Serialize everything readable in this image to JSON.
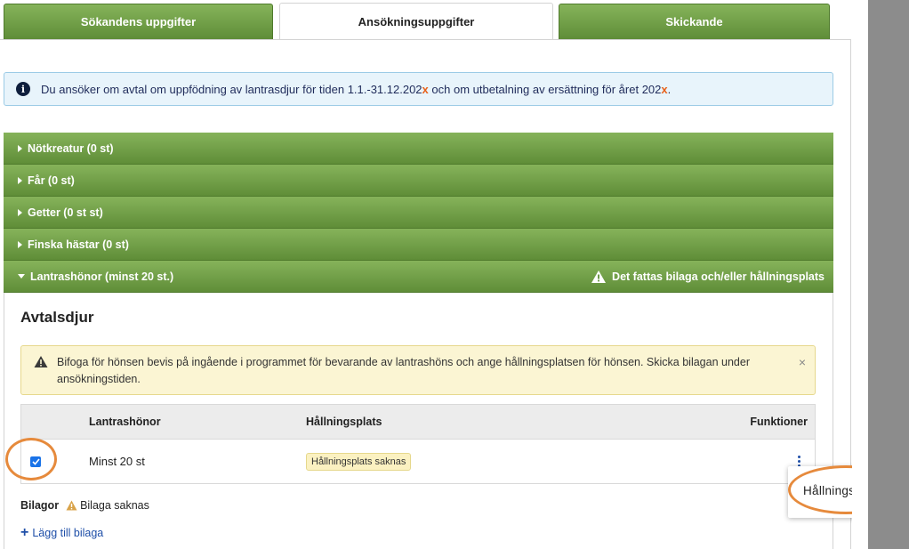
{
  "tabs": [
    {
      "label": "Sökandens uppgifter",
      "active": false
    },
    {
      "label": "Ansökningsuppgifter",
      "active": true
    },
    {
      "label": "Skickande",
      "active": false
    }
  ],
  "info": {
    "text_before": "Du ansöker om avtal om uppfödning av lantrasdjur för tiden 1.1.-31.12.202",
    "x1": "x",
    "text_middle": " och om utbetalning av ersättning för året 202",
    "x2": "x",
    "text_end": ".",
    "icon": "info-icon"
  },
  "accordion": [
    {
      "label": "Nötkreatur (0 st)",
      "expanded": false
    },
    {
      "label": "Får (0 st)",
      "expanded": false
    },
    {
      "label": "Getter (0 st st)",
      "expanded": false
    },
    {
      "label": "Finska hästar (0 st)",
      "expanded": false
    },
    {
      "label": "Lantrashönor (minst 20 st.)",
      "expanded": true,
      "warning": "Det fattas bilaga och/eller hållningsplats"
    }
  ],
  "section_title": "Avtalsdjur",
  "warning_box": {
    "text": "Bifoga för hönsen bevis på ingående i programmet för bevarande av lantrashöns och ange hållningsplatsen för hönsen. Skicka bilagan under ansökningstiden.",
    "close": "×"
  },
  "table": {
    "headers": {
      "col1": "Lantrashönor",
      "col2": "Hållningsplats",
      "col3": "Funktioner"
    },
    "row": {
      "checked": true,
      "col1": "Minst 20 st",
      "badge": "Hållningsplats saknas"
    }
  },
  "attachments": {
    "label": "Bilagor",
    "status": "Bilaga saknas",
    "add_label": "Lägg till bilaga"
  },
  "popup_menu": {
    "item": "Hållningsplats"
  },
  "colors": {
    "green_top": "#86b35a",
    "green_bottom": "#5f8d38",
    "info_bg": "#e8f4fb",
    "warning_bg": "#fbf5d3",
    "highlight_orange": "#e68a3c",
    "link_blue": "#1f4fa8"
  }
}
